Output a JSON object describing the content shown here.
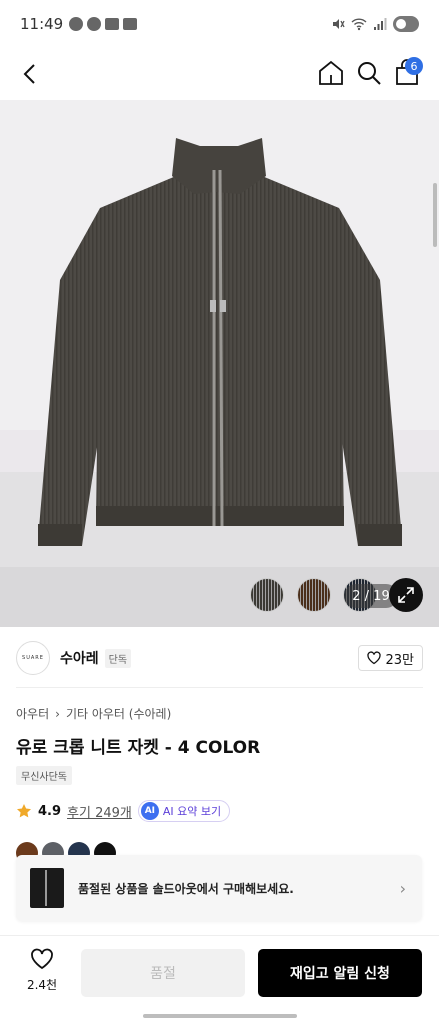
{
  "status_bar": {
    "time": "11:49"
  },
  "header": {
    "cart_count": "6"
  },
  "gallery": {
    "counter": "2 / 19",
    "swatch_colors": [
      "#3b3934",
      "#4a2e1a",
      "#1d2530"
    ]
  },
  "brand": {
    "logo_text": "SUARE",
    "name": "수아레",
    "tag": "단독",
    "likes": "23만"
  },
  "product": {
    "breadcrumb": [
      "아우터",
      "기타 아우터 (수아레)"
    ],
    "title": "유로 크롭 니트 자켓 - 4 COLOR",
    "exclusive_tag": "무신사단독",
    "rating": "4.9",
    "reviews": "후기 249개",
    "ai_summary": "AI 요약 보기",
    "ai_badge": "AI",
    "color_options": [
      "#6b3a1c",
      "#5d6066",
      "#24344d",
      "#111111"
    ]
  },
  "banner": {
    "text": "품절된 상품을 솔드아웃에서 구매해보세요."
  },
  "bottom_bar": {
    "wish_count": "2.4천",
    "soldout_label": "품절",
    "notify_label": "재입고 알림 신청"
  },
  "colors": {
    "accent": "#2f6fe4",
    "ai_purple": "#5b3ed8",
    "primary_button": "#000000"
  }
}
